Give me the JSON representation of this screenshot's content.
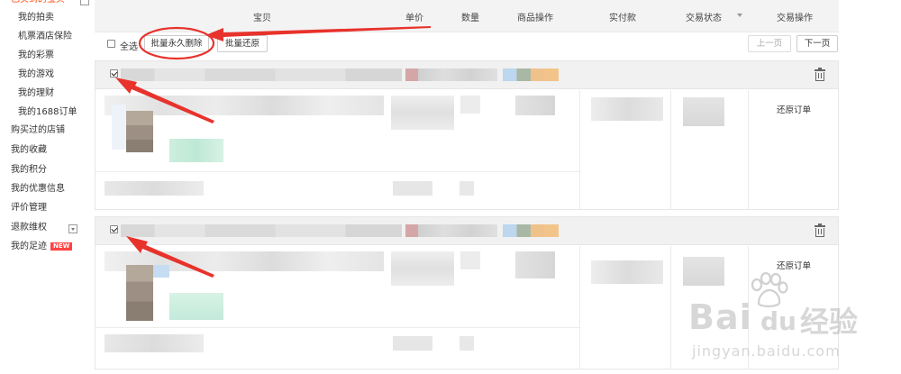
{
  "sidebar": {
    "cutoff_label": "已买到的宝贝",
    "items": [
      {
        "label": "我的拍卖",
        "level": "sub"
      },
      {
        "label": "机票酒店保险",
        "level": "sub"
      },
      {
        "label": "我的彩票",
        "level": "sub"
      },
      {
        "label": "我的游戏",
        "level": "sub"
      },
      {
        "label": "我的理财",
        "level": "sub"
      },
      {
        "label": "我的1688订单",
        "level": "sub"
      },
      {
        "label": "购买过的店铺",
        "level": "top"
      },
      {
        "label": "我的收藏",
        "level": "top"
      },
      {
        "label": "我的积分",
        "level": "top"
      },
      {
        "label": "我的优惠信息",
        "level": "top"
      },
      {
        "label": "评价管理",
        "level": "top"
      },
      {
        "label": "退款维权",
        "level": "top"
      },
      {
        "label": "我的足迹",
        "level": "top"
      }
    ],
    "new_badge": "NEW"
  },
  "header": {
    "columns": [
      "宝贝",
      "单价",
      "数量",
      "商品操作",
      "实付款",
      "交易状态",
      "交易操作"
    ]
  },
  "toolbar": {
    "select_all": "全选",
    "batch_delete": "批量永久删除",
    "batch_restore": "批量还原",
    "prev_page": "上一页",
    "next_page": "下一页"
  },
  "orders": [
    {
      "checked": true,
      "action": "还原订单"
    },
    {
      "checked": true,
      "action": "还原订单"
    }
  ],
  "watermark": {
    "brand_latin": "Bai",
    "brand_du": "du",
    "brand_cn": "经验",
    "url": "jingyan.baidu.com"
  },
  "colors": {
    "annotation_red": "#e8322c",
    "sidebar_accent": "#ff4400",
    "new_badge": "#ff4444"
  }
}
